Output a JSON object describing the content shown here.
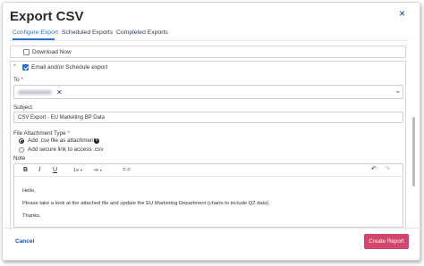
{
  "dialog": {
    "title": "Export CSV",
    "close_label": "×"
  },
  "tabs": [
    {
      "label": "Configure Export",
      "active": true
    },
    {
      "label": "Scheduled Exports",
      "active": false
    },
    {
      "label": "Completed Exports",
      "active": false
    }
  ],
  "download_now": {
    "label": "Download Now",
    "checked": false
  },
  "email_section": {
    "label": "Email and/or Schedule export",
    "checked": true,
    "collapse_caret": "^"
  },
  "to_field": {
    "label": "To",
    "required_mark": "*",
    "chip_remove": "✕",
    "dropdown_caret": "⌄"
  },
  "subject_field": {
    "label": "Subject",
    "value": "CSV Export - EU Marketing BP Data"
  },
  "attachment_type": {
    "label": "File Attachment Type",
    "required_mark": "*",
    "options": [
      {
        "label": "Add .csv file as attachment",
        "selected": true
      },
      {
        "label": "Add secure link to access .csv",
        "selected": false
      }
    ],
    "info_icon": "i"
  },
  "note_field": {
    "label": "Note",
    "toolbar": {
      "bold": "B",
      "italic": "I",
      "underline": "U",
      "ordered_list": "1≡",
      "bullet_list": "•≡",
      "caret": "▾",
      "link": "⊂⊃",
      "undo": "↶",
      "redo": "↷"
    },
    "lines": [
      "Hello,",
      "Please take a look at the attached file and update the EU Marketing Department (charts to include Q2 data).",
      "Thanks,"
    ]
  },
  "footer": {
    "cancel_label": "Cancel",
    "create_label": "Create Report"
  },
  "colors": {
    "accent": "#2a73c9",
    "primary_button": "#d1466a",
    "link": "#1f4fa8"
  }
}
